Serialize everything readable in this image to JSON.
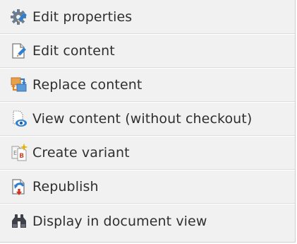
{
  "menu": {
    "items": [
      {
        "label": "Edit properties",
        "icon": "gear-pencil-icon"
      },
      {
        "label": "Edit content",
        "icon": "document-pencil-icon"
      },
      {
        "label": "Replace content",
        "icon": "replace-documents-icon"
      },
      {
        "label": "View content (without checkout)",
        "icon": "document-eye-icon"
      },
      {
        "label": "Create variant",
        "icon": "document-variant-icon"
      },
      {
        "label": "Republish",
        "icon": "document-republish-icon"
      },
      {
        "label": "Display in document view",
        "icon": "binoculars-icon"
      }
    ]
  }
}
